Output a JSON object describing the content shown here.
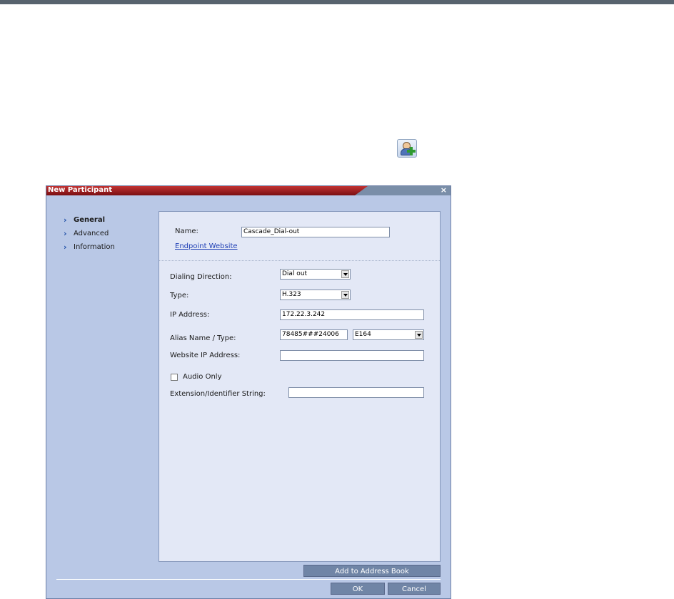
{
  "dialog": {
    "title": "New Participant",
    "close": "×"
  },
  "nav": {
    "items": [
      {
        "label": "General",
        "active": true
      },
      {
        "label": "Advanced",
        "active": false
      },
      {
        "label": "Information",
        "active": false
      }
    ]
  },
  "general": {
    "name_label": "Name:",
    "name_value": "Cascade_Dial-out",
    "endpoint_link": "Endpoint Website",
    "dialing_direction_label": "Dialing Direction:",
    "dialing_direction_value": "Dial out",
    "type_label": "Type:",
    "type_value": "H.323",
    "ip_label": "IP Address:",
    "ip_value": "172.22.3.242",
    "alias_label": "Alias Name / Type:",
    "alias_name_value": "78485###24006",
    "alias_type_value": "E164",
    "website_ip_label": "Website IP Address:",
    "website_ip_value": "",
    "audio_only_label": "Audio Only",
    "audio_only_checked": false,
    "extension_label": "Extension/Identifier String:",
    "extension_value": ""
  },
  "buttons": {
    "add_to_address_book": "Add to Address Book",
    "ok": "OK",
    "cancel": "Cancel"
  },
  "colors": {
    "title_red": "#a01c1f",
    "panel_bg": "#e3e8f6",
    "dialog_bg": "#b9c8e6",
    "button_bg": "#7085a6"
  }
}
